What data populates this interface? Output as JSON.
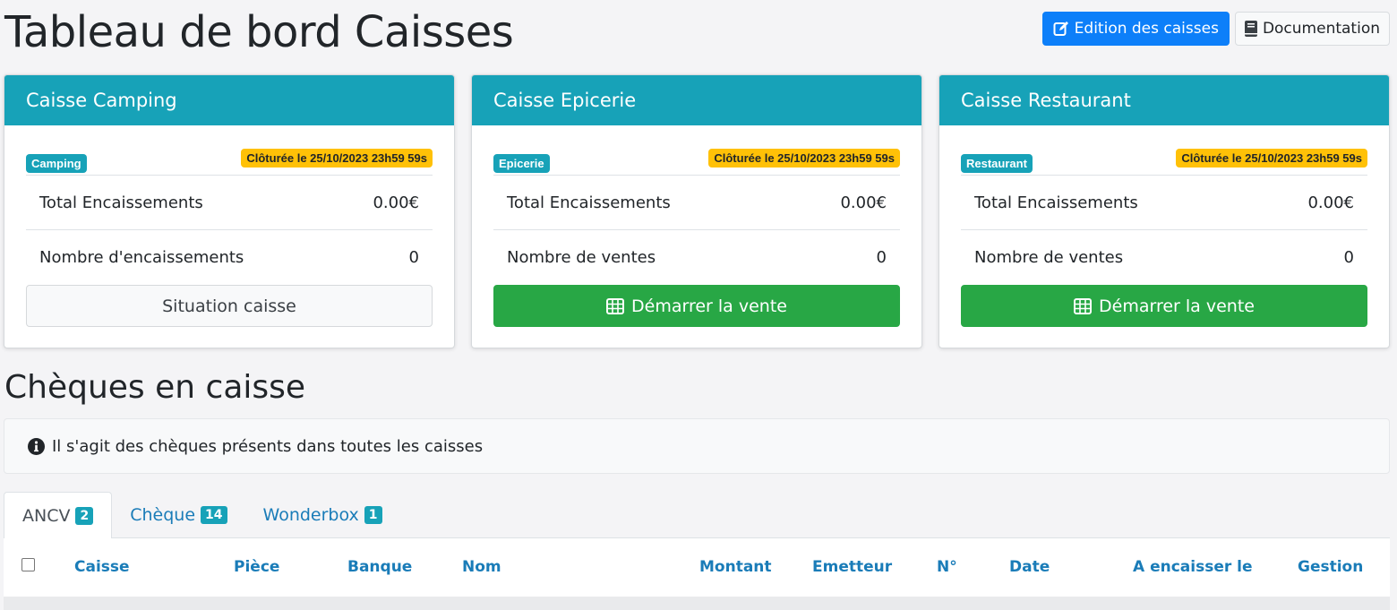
{
  "page": {
    "title": "Tableau de bord Caisses"
  },
  "toolbar": {
    "edit_label": "Edition des caisses",
    "doc_label": "Documentation"
  },
  "colors": {
    "primary": "#0d7ff9",
    "info": "#17a2b8",
    "warning": "#ffc107",
    "success": "#28a745"
  },
  "cards": [
    {
      "title": "Caisse Camping",
      "tag": "Camping",
      "status": "Clôturée le 25/10/2023 23h59 59s",
      "row1_label": "Total Encaissements",
      "row1_value": "0.00€",
      "row2_label": "Nombre d'encaissements",
      "row2_value": "0",
      "button_label": "Situation caisse"
    },
    {
      "title": "Caisse Epicerie",
      "tag": "Epicerie",
      "status": "Clôturée le 25/10/2023 23h59 59s",
      "row1_label": "Total Encaissements",
      "row1_value": "0.00€",
      "row2_label": "Nombre de ventes",
      "row2_value": "0",
      "button_label": "Démarrer la vente"
    },
    {
      "title": "Caisse Restaurant",
      "tag": "Restaurant",
      "status": "Clôturée le 25/10/2023 23h59 59s",
      "row1_label": "Total Encaissements",
      "row1_value": "0.00€",
      "row2_label": "Nombre de ventes",
      "row2_value": "0",
      "button_label": "Démarrer la vente"
    }
  ],
  "cheques": {
    "title": "Chèques en caisse",
    "info": "Il s'agit des chèques présents dans toutes les caisses",
    "tabs": [
      {
        "label": "ANCV",
        "count": "2"
      },
      {
        "label": "Chèque",
        "count": "14"
      },
      {
        "label": "Wonderbox",
        "count": "1"
      }
    ],
    "columns": [
      "Caisse",
      "Pièce",
      "Banque",
      "Nom",
      "Montant",
      "Emetteur",
      "N°",
      "Date",
      "A encaisser le",
      "Gestion"
    ]
  }
}
